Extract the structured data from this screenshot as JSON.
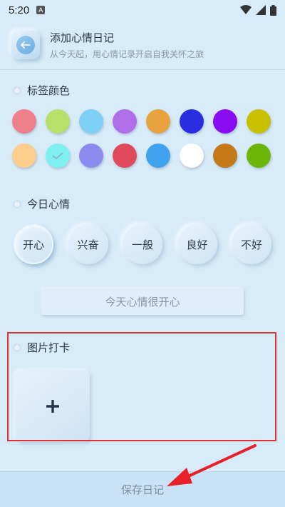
{
  "status_bar": {
    "time": "5:20",
    "indicator": "A"
  },
  "header": {
    "title": "添加心情日记",
    "subtitle": "从今天起，用心情记录开启自我关怀之旅"
  },
  "tag_color": {
    "label": "标签颜色",
    "colors": [
      "#f07f8c",
      "#b6e06a",
      "#7fd0f6",
      "#b16eea",
      "#e8a23e",
      "#2b2ee0",
      "#8a0df2",
      "#c8c000",
      "#ffcd8c",
      "#7ff0f0",
      "#8c8cf0",
      "#e04a5a",
      "#3fa2ef",
      "#ffffff",
      "#c47a18",
      "#6cb60a"
    ],
    "selected_index": 9
  },
  "today_mood": {
    "label": "今日心情",
    "options": [
      "开心",
      "兴奋",
      "一般",
      "良好",
      "不好"
    ],
    "selected_index": 0,
    "text_value": "今天心情很开心"
  },
  "photo_checkin": {
    "label": "图片打卡",
    "add_symbol": "+"
  },
  "save_button": {
    "label": "保存日记"
  },
  "annotation_colors": {
    "highlight": "#e03030",
    "arrow": "#e8202a"
  }
}
